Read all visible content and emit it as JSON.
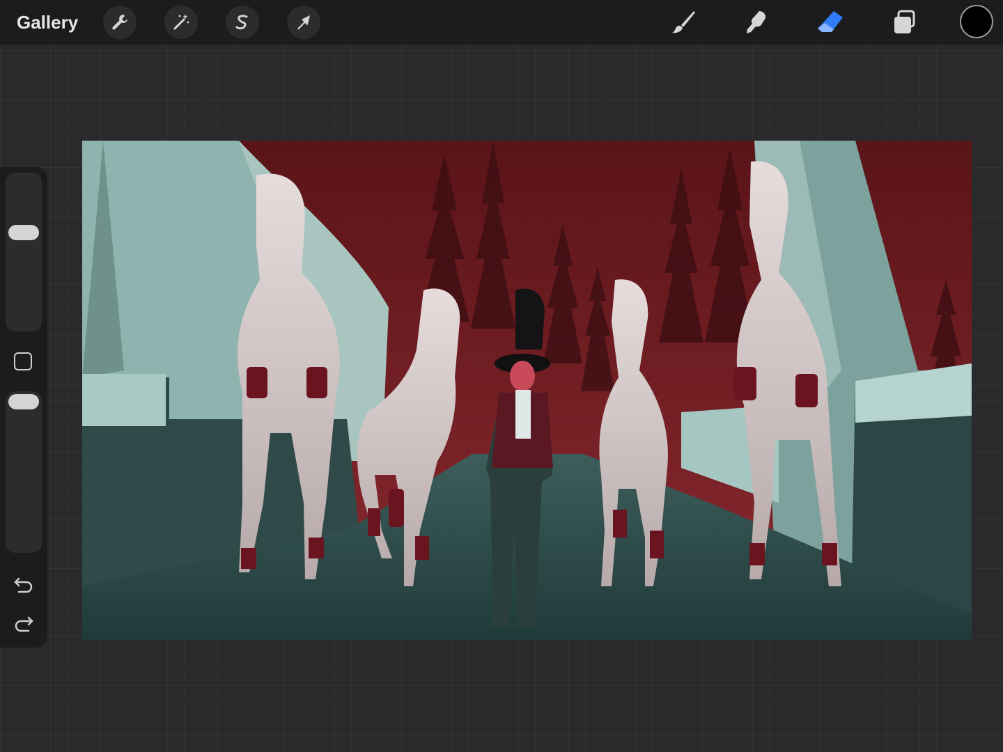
{
  "toolbar": {
    "gallery_label": "Gallery",
    "left_tools": [
      {
        "name": "actions",
        "icon": "wrench-icon"
      },
      {
        "name": "adjustments",
        "icon": "magic-wand-icon"
      },
      {
        "name": "selection",
        "icon": "selection-s-icon"
      },
      {
        "name": "transform",
        "icon": "arrow-cursor-icon"
      }
    ],
    "right_tools": [
      {
        "name": "brush",
        "icon": "brush-icon",
        "active": false
      },
      {
        "name": "smudge",
        "icon": "smudge-icon",
        "active": false
      },
      {
        "name": "eraser",
        "icon": "eraser-icon",
        "active": true
      },
      {
        "name": "layers",
        "icon": "layers-icon",
        "active": false
      }
    ],
    "current_color": "#000000",
    "active_color": "#2f7cf6"
  },
  "sidebar": {
    "brush_size": 0.64,
    "opacity": 1.0,
    "buttons": [
      "modify-button",
      "undo-button",
      "redo-button"
    ]
  },
  "canvas": {
    "artwork": "horses-and-rider-scene"
  }
}
